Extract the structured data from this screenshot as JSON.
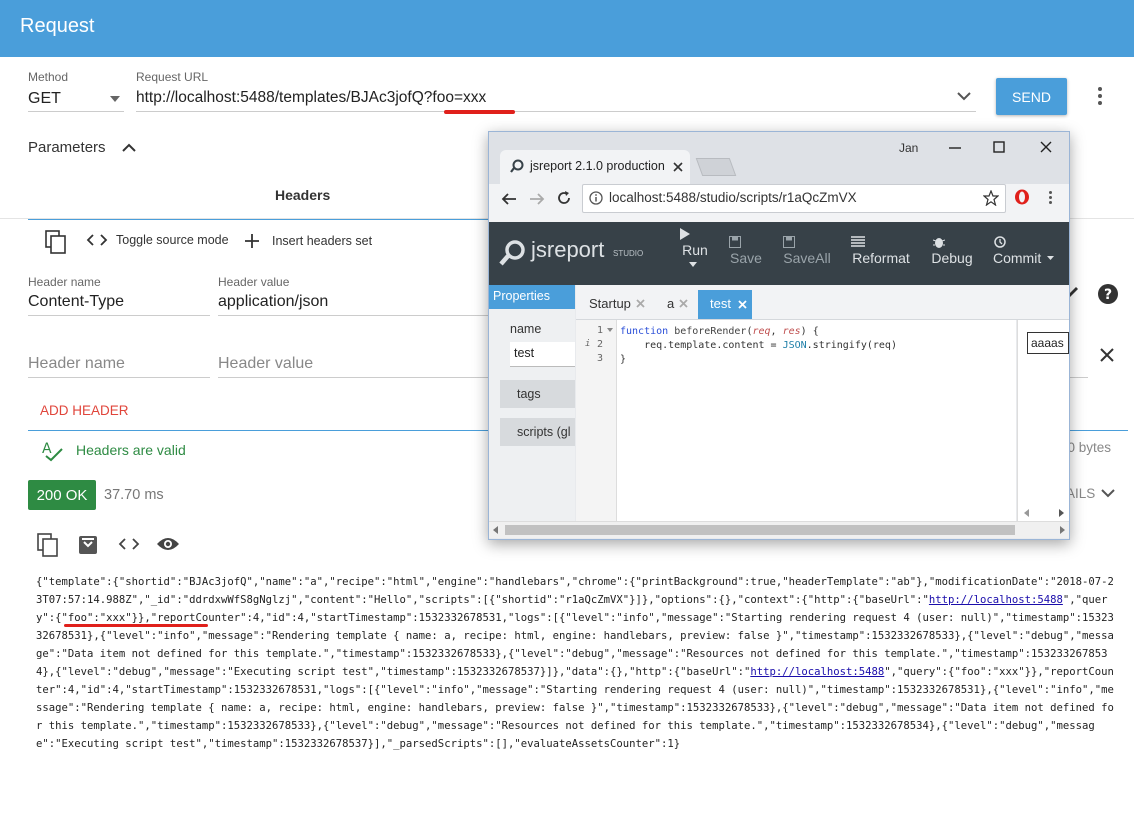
{
  "app": {
    "title": "Request"
  },
  "request": {
    "method_label": "Method",
    "method_value": "GET",
    "url_label": "Request URL",
    "url_value": "http://localhost:5488/templates/BJAc3jofQ?foo=xxx",
    "send_label": "SEND"
  },
  "parameters": {
    "title": "Parameters",
    "headers_tab": "Headers"
  },
  "toolbar": {
    "toggle_source": "Toggle source mode",
    "insert_headers": "Insert headers set"
  },
  "headers": {
    "name_label": "Header name",
    "value_label": "Header value",
    "rows": [
      {
        "name": "Content-Type",
        "value": "application/json"
      }
    ],
    "name_placeholder": "Header name",
    "value_placeholder": "Header value",
    "add_header": "ADD HEADER",
    "valid_text": "Headers are valid",
    "bytes_fragment": "30 bytes"
  },
  "response": {
    "status": "200 OK",
    "time": "37.70 ms",
    "details_fragment": "AILS",
    "body_parts": [
      "{\"template\":{\"shortid\":\"BJAc3jofQ\",\"name\":\"a\",\"recipe\":\"html\",\"engine\":\"handlebars\",\"chrome\":{\"printBackground\":true,\"headerTemplate\":\"ab\"},\"modificationDate\":\"2018-07-23T07:57:14.988Z\",\"_id\":\"ddrdxwWfS8gNglzj\",\"content\":\"Hello\",\"scripts\":[{\"shortid\":\"r1aQcZmVX\"}]},\"options\":{},\"context\":{\"http\":{\"baseUrl\":\"",
      "http://localhost:5488",
      "\",\"query\":{\"foo\":\"xxx\"}},\"reportCounter\":4,\"id\":4,\"startTimestamp\":1532332678531,\"logs\":[{\"level\":\"info\",\"message\":\"Starting rendering request 4 (user: null)\",\"timestamp\":1532332678531},{\"level\":\"info\",\"message\":\"Rendering template { name: a, recipe: html, engine: handlebars, preview: false }\",\"timestamp\":1532332678533},{\"level\":\"debug\",\"message\":\"Data item not defined for this template.\",\"timestamp\":1532332678533},{\"level\":\"debug\",\"message\":\"Resources not defined for this template.\",\"timestamp\":1532332678534},{\"level\":\"debug\",\"message\":\"Executing script test\",\"timestamp\":1532332678537}]},\"data\":{},\"http\":{\"baseUrl\":\"",
      "http://localhost:5488",
      "\",\"query\":{\"foo\":\"xxx\"}},\"reportCounter\":4,\"id\":4,\"startTimestamp\":1532332678531,\"logs\":[{\"level\":\"info\",\"message\":\"Starting rendering request 4 (user: null)\",\"timestamp\":1532332678531},{\"level\":\"info\",\"message\":\"Rendering template { name: a, recipe: html, engine: handlebars, preview: false }\",\"timestamp\":1532332678533},{\"level\":\"debug\",\"message\":\"Data item not defined for this template.\",\"timestamp\":1532332678533},{\"level\":\"debug\",\"message\":\"Resources not defined for this template.\",\"timestamp\":1532332678534},{\"level\":\"debug\",\"message\":\"Executing script test\",\"timestamp\":1532332678537}],\"_parsedScripts\":[],\"evaluateAssetsCounter\":1}"
    ]
  },
  "popup": {
    "tab_title": "jsreport 2.1.0 production",
    "user": "Jan",
    "address": "localhost:5488/studio/scripts/r1aQcZmVX",
    "logo_text": "jsreport",
    "logo_sub": "STUDIO",
    "toolbar": {
      "run": "Run",
      "save": "Save",
      "saveall": "SaveAll",
      "reformat": "Reformat",
      "debug": "Debug",
      "commit": "Commit"
    },
    "properties_title": "Properties",
    "name_label": "name",
    "name_value": "test",
    "tags_label": "tags",
    "scripts_label": "scripts (gl",
    "tabs": [
      "Startup",
      "a",
      "test"
    ],
    "code_lines": [
      "1",
      "2",
      "3"
    ],
    "right_input": "aaaas"
  },
  "colors": {
    "primary": "#4a9eda",
    "success": "#2e8b43",
    "danger": "#e0201b",
    "studio_dark": "#374148"
  }
}
